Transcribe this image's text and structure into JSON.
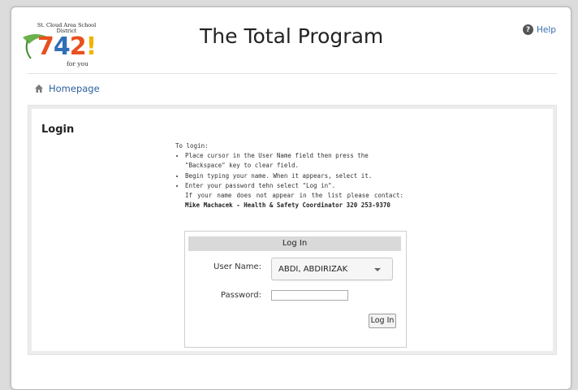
{
  "header": {
    "logo_district": "St. Cloud Area School District",
    "logo_number": [
      "7",
      "4",
      "2",
      "!"
    ],
    "logo_tagline": "for you",
    "title": "The Total Program",
    "help_label": "Help"
  },
  "nav": {
    "home_label": "Homepage"
  },
  "login": {
    "heading": "Login",
    "instructions_intro": "To login:",
    "instructions": [
      "Place cursor in the User Name field then press the \"Backspace\" key to clear field.",
      "Begin typing your name. When it appears, select it.",
      "Enter your password tehn select \"Log in\"."
    ],
    "contact_prefix": "If your name does not appear in the list please contact: ",
    "contact_bold": "Mike Machacek - Health & Safety Coordinator 320 253-9370",
    "box_title": "Log In",
    "username_label": "User Name:",
    "username_value": "ABDI, ABDIRIZAK",
    "password_label": "Password:",
    "password_value": "",
    "submit_label": "Log In"
  },
  "colors": {
    "link": "#2c5f9e",
    "panel_bg": "#ececec",
    "box_header": "#d9d9d9"
  }
}
